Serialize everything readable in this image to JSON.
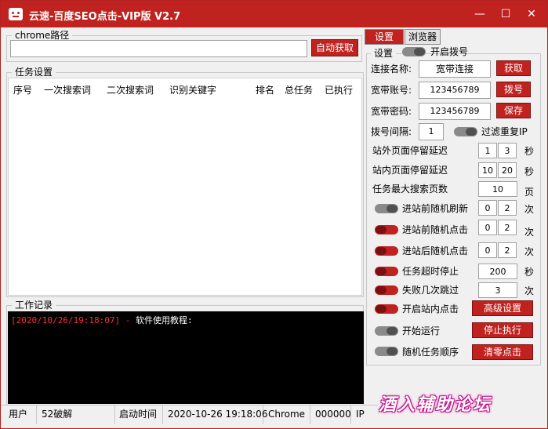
{
  "window": {
    "title": "云速-百度SEO点击-VIP版 V2.7",
    "minimize": "—",
    "maximize": "☐",
    "close": "✕"
  },
  "chrome_path": {
    "group_label": "chrome路径",
    "value": "",
    "auto_button": "自动获取"
  },
  "task_settings": {
    "group_label": "任务设置",
    "columns": [
      "序号",
      "一次搜索词",
      "二次搜索词",
      "识别关键字",
      "排名",
      "总任务",
      "已执行"
    ]
  },
  "work_log": {
    "group_label": "工作记录",
    "lines": [
      {
        "timestamp": "[2020/10/26/19:18:07]",
        "separator": " - ",
        "message": "软件使用教程:"
      }
    ]
  },
  "status_bar": {
    "user_label": "用户",
    "user_value": "52破解",
    "start_label": "启动时间",
    "start_value": "2020-10-26 19:18:06",
    "browser": "Chrome",
    "code": "000000",
    "ip_label": "IP"
  },
  "tabs": [
    {
      "label": "设置",
      "active": true
    },
    {
      "label": "浏览器",
      "active": false
    }
  ],
  "settings": {
    "group_label": "设置",
    "dialup_toggle_label": "开启拨号",
    "conn_name_label": "连接名称:",
    "conn_name_value": "宽带连接",
    "fetch_button": "获取",
    "account_label": "宽带账号:",
    "account_value": "123456789",
    "dial_button": "拨号",
    "password_label": "宽带密码:",
    "password_value": "123456789",
    "save_button": "保存",
    "interval_label": "拨号间隔:",
    "interval_value": "1",
    "filter_ip_label": "过滤重复IP",
    "outside_delay_label": "站外页面停留延迟",
    "outside_delay_min": "1",
    "outside_delay_max": "3",
    "outside_delay_unit": "秒",
    "inside_delay_label": "站内页面停留延迟",
    "inside_delay_min": "10",
    "inside_delay_max": "20",
    "inside_delay_unit": "秒",
    "max_pages_label": "任务最大搜索页数",
    "max_pages_value": "10",
    "max_pages_unit": "页",
    "pre_refresh_label": "进站前随机刷新",
    "pre_refresh_min": "0",
    "pre_refresh_max": "2",
    "pre_refresh_unit": "次",
    "pre_click_label": "进站前随机点击",
    "pre_click_min": "0",
    "pre_click_max": "2",
    "pre_click_unit": "次",
    "post_click_label": "进站后随机点击",
    "post_click_min": "0",
    "post_click_max": "2",
    "post_click_unit": "次",
    "timeout_label": "任务超时停止",
    "timeout_value": "200",
    "timeout_unit": "秒",
    "fail_skip_label": "失败几次跳过",
    "fail_skip_value": "3",
    "fail_skip_unit": "次",
    "inner_click_label": "开启站内点击",
    "advanced_button": "高级设置",
    "start_run_label": "开始运行",
    "stop_button": "停止执行",
    "random_order_label": "随机任务顺序",
    "clear_button": "清零点击"
  },
  "watermark": "酒入辅助论坛",
  "colors": {
    "accent": "#c0221f",
    "log_timestamp": "#ff3030",
    "log_text": "#ffffff"
  }
}
